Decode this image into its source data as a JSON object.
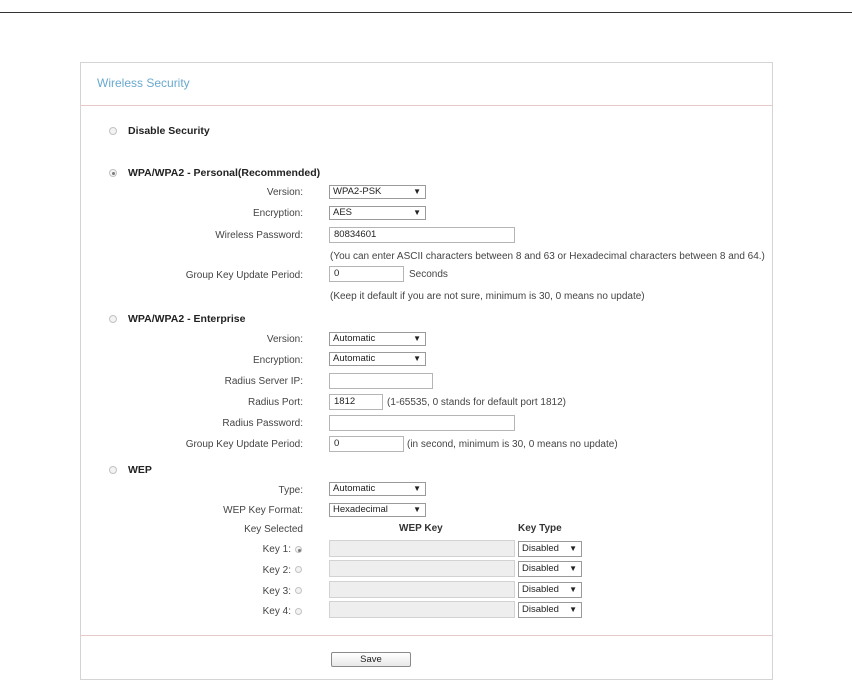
{
  "title": "Wireless Security",
  "disable": {
    "label": "Disable Security"
  },
  "wpa_personal": {
    "label": "WPA/WPA2 - Personal(Recommended)",
    "version_label": "Version:",
    "version_value": "WPA2-PSK",
    "encryption_label": "Encryption:",
    "encryption_value": "AES",
    "password_label": "Wireless Password:",
    "password_value": "80834601",
    "password_note": "(You can enter ASCII characters between 8 and 63 or Hexadecimal characters between 8 and 64.)",
    "group_key_label": "Group Key Update Period:",
    "group_key_value": "0",
    "group_key_unit": "Seconds",
    "group_key_note": "(Keep it default if you are not sure, minimum is 30, 0 means no update)"
  },
  "wpa_enterprise": {
    "label": "WPA/WPA2 - Enterprise",
    "version_label": "Version:",
    "version_value": "Automatic",
    "encryption_label": "Encryption:",
    "encryption_value": "Automatic",
    "radius_ip_label": "Radius Server IP:",
    "radius_ip_value": "",
    "radius_port_label": "Radius Port:",
    "radius_port_value": "1812",
    "radius_port_note": "(1-65535, 0 stands for default port 1812)",
    "radius_password_label": "Radius Password:",
    "radius_password_value": "",
    "group_key_label": "Group Key Update Period:",
    "group_key_value": "0",
    "group_key_note": "(in second, minimum is 30, 0 means no update)"
  },
  "wep": {
    "label": "WEP",
    "type_label": "Type:",
    "type_value": "Automatic",
    "format_label": "WEP Key Format:",
    "format_value": "Hexadecimal",
    "col_selected": "Key Selected",
    "col_key": "WEP Key",
    "col_type": "Key Type",
    "keys": [
      {
        "label": "Key 1:",
        "value": "",
        "type": "Disabled"
      },
      {
        "label": "Key 2:",
        "value": "",
        "type": "Disabled"
      },
      {
        "label": "Key 3:",
        "value": "",
        "type": "Disabled"
      },
      {
        "label": "Key 4:",
        "value": "",
        "type": "Disabled"
      }
    ]
  },
  "save_label": "Save"
}
